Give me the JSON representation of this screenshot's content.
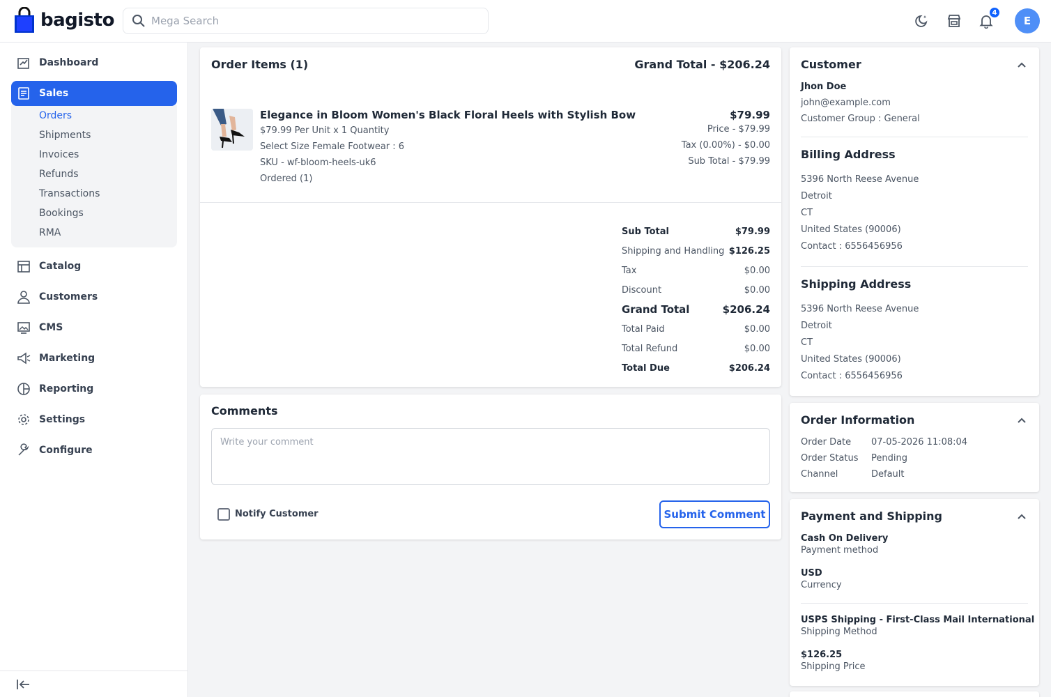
{
  "header": {
    "logo_text": "bagisto",
    "search_placeholder": "Mega Search",
    "notification_count": "4",
    "avatar_initial": "E"
  },
  "sidebar": {
    "items": [
      {
        "label": "Dashboard",
        "icon": "dashboard-icon"
      },
      {
        "label": "Sales",
        "icon": "sales-icon"
      },
      {
        "label": "Catalog",
        "icon": "catalog-icon"
      },
      {
        "label": "Customers",
        "icon": "customers-icon"
      },
      {
        "label": "CMS",
        "icon": "cms-icon"
      },
      {
        "label": "Marketing",
        "icon": "marketing-icon"
      },
      {
        "label": "Reporting",
        "icon": "reporting-icon"
      },
      {
        "label": "Settings",
        "icon": "settings-icon"
      },
      {
        "label": "Configure",
        "icon": "configure-icon"
      }
    ],
    "sales_sub": [
      "Orders",
      "Shipments",
      "Invoices",
      "Refunds",
      "Transactions",
      "Bookings",
      "RMA"
    ]
  },
  "order_items": {
    "title": "Order Items (1)",
    "grand_total_header": "Grand Total - $206.24",
    "item": {
      "name": "Elegance in Bloom Women's Black Floral Heels with Stylish Bow",
      "unit_line": "$79.99 Per Unit x 1 Quantity",
      "option_line": "Select Size Female Footwear : 6",
      "sku_line": "SKU - wf-bloom-heels-uk6",
      "ordered_line": "Ordered (1)",
      "total": "$79.99",
      "price": "Price - $79.99",
      "tax": "Tax (0.00%) - $0.00",
      "subtotal": "Sub Total - $79.99"
    },
    "summary": [
      {
        "label": "Sub Total",
        "value": "$79.99"
      },
      {
        "label": "Shipping and Handling",
        "value": "$126.25"
      },
      {
        "label": "Tax",
        "value": "$0.00"
      },
      {
        "label": "Discount",
        "value": "$0.00"
      },
      {
        "label": "Grand Total",
        "value": "$206.24"
      },
      {
        "label": "Total Paid",
        "value": "$0.00"
      },
      {
        "label": "Total Refund",
        "value": "$0.00"
      },
      {
        "label": "Total Due",
        "value": "$206.24"
      }
    ]
  },
  "comments": {
    "title": "Comments",
    "placeholder": "Write your comment",
    "notify_label": "Notify Customer",
    "submit_label": "Submit Comment"
  },
  "customer": {
    "title": "Customer",
    "name": "Jhon Doe",
    "email": "john@example.com",
    "group": "Customer Group : General",
    "billing_title": "Billing Address",
    "billing": [
      "5396 North Reese Avenue",
      "Detroit",
      "CT",
      "United States (90006)",
      "Contact : 6556456956"
    ],
    "shipping_title": "Shipping Address",
    "shipping": [
      "5396 North Reese Avenue",
      "Detroit",
      "CT",
      "United States (90006)",
      "Contact : 6556456956"
    ]
  },
  "order_info": {
    "title": "Order Information",
    "rows": [
      {
        "label": "Order Date",
        "value": "07-05-2026 11:08:04"
      },
      {
        "label": "Order Status",
        "value": "Pending"
      },
      {
        "label": "Channel",
        "value": "Default"
      }
    ]
  },
  "payment_shipping": {
    "title": "Payment and Shipping",
    "payment_method": "Cash On Delivery",
    "payment_method_label": "Payment method",
    "currency": "USD",
    "currency_label": "Currency",
    "shipping_method": "USPS Shipping - First-Class Mail International",
    "shipping_method_label": "Shipping Method",
    "shipping_price": "$126.25",
    "shipping_price_label": "Shipping Price"
  },
  "colors": {
    "accent": "#2563eb",
    "logo_bag": "#0033cc"
  }
}
